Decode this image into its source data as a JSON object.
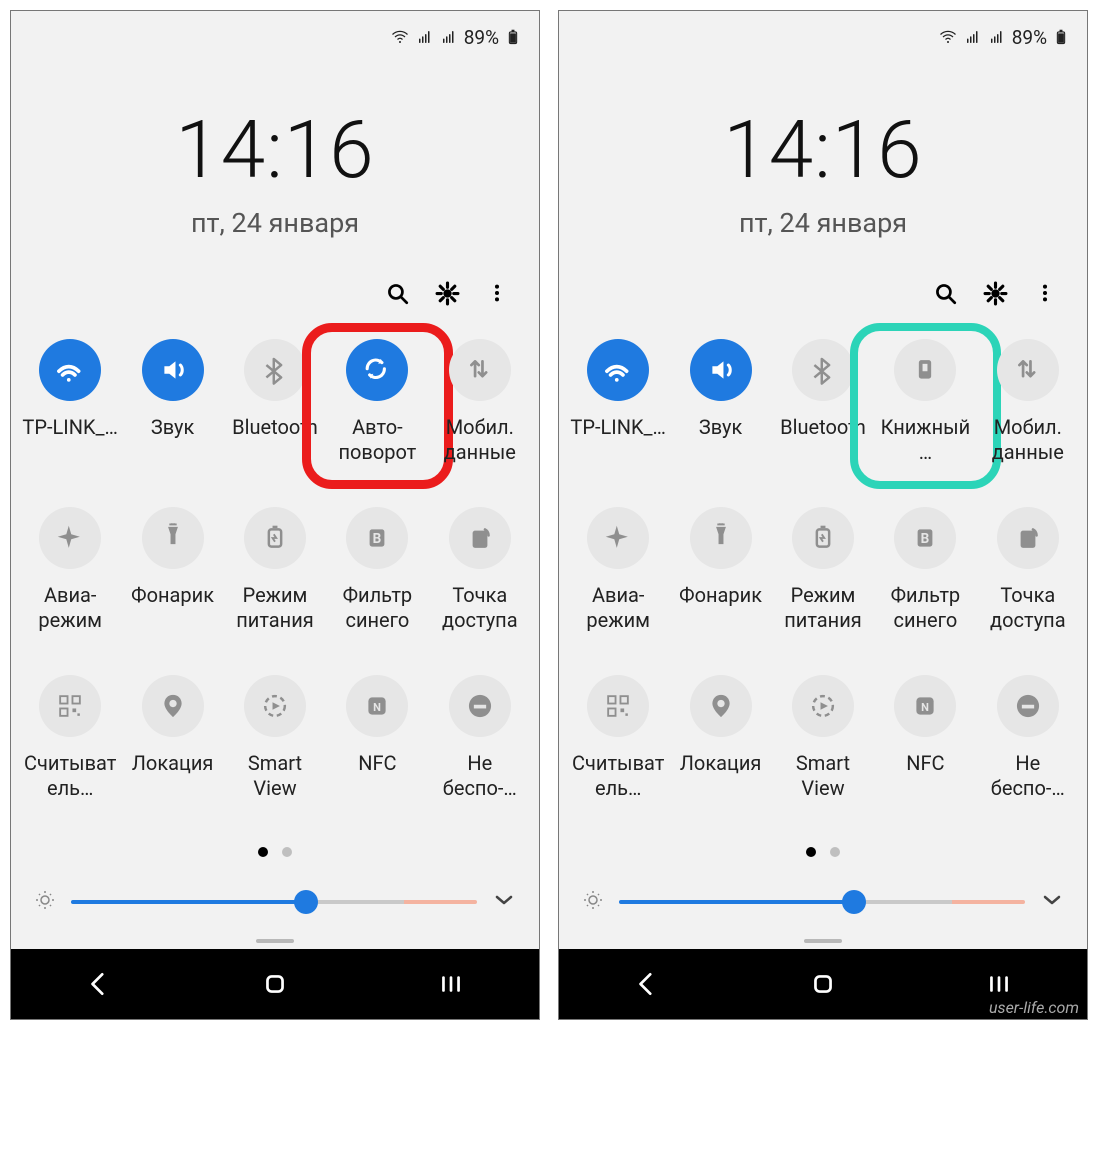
{
  "status": {
    "battery": "89%"
  },
  "clock": {
    "time": "14:16",
    "date": "пт, 24 января"
  },
  "tiles_left": [
    {
      "id": "wifi",
      "label": "TP-LINK_…",
      "on": true,
      "icon": "wifi"
    },
    {
      "id": "sound",
      "label": "Звук",
      "on": true,
      "icon": "sound"
    },
    {
      "id": "bluetooth",
      "label": "Bluetooth",
      "on": false,
      "icon": "bluetooth"
    },
    {
      "id": "rotate",
      "label": "Авто-поворот",
      "on": true,
      "icon": "rotate",
      "highlight": "red"
    },
    {
      "id": "data",
      "label": "Мобил. данные",
      "on": false,
      "icon": "data"
    },
    {
      "id": "airplane",
      "label": "Авиа-режим",
      "on": false,
      "icon": "airplane"
    },
    {
      "id": "torch",
      "label": "Фонарик",
      "on": false,
      "icon": "torch"
    },
    {
      "id": "power",
      "label": "Режим питания",
      "on": false,
      "icon": "battery"
    },
    {
      "id": "bluelight",
      "label": "Фильтр синего",
      "on": false,
      "icon": "filter"
    },
    {
      "id": "hotspot",
      "label": "Точка доступа",
      "on": false,
      "icon": "hotspot"
    },
    {
      "id": "scanner",
      "label": "Считыватель…",
      "on": false,
      "icon": "qr"
    },
    {
      "id": "location",
      "label": "Локация",
      "on": false,
      "icon": "location"
    },
    {
      "id": "smartview",
      "label": "Smart View",
      "on": false,
      "icon": "smartview"
    },
    {
      "id": "nfc",
      "label": "NFC",
      "on": false,
      "icon": "nfc"
    },
    {
      "id": "dnd",
      "label": "Не беспо-…",
      "on": false,
      "icon": "dnd"
    }
  ],
  "tiles_right": [
    {
      "id": "wifi",
      "label": "TP-LINK_…",
      "on": true,
      "icon": "wifi"
    },
    {
      "id": "sound",
      "label": "Звук",
      "on": true,
      "icon": "sound"
    },
    {
      "id": "bluetooth",
      "label": "Bluetooth",
      "on": false,
      "icon": "bluetooth"
    },
    {
      "id": "portrait",
      "label": "Книжный…",
      "on": false,
      "icon": "portrait",
      "highlight": "teal"
    },
    {
      "id": "data",
      "label": "Мобил. данные",
      "on": false,
      "icon": "data"
    },
    {
      "id": "airplane",
      "label": "Авиа-режим",
      "on": false,
      "icon": "airplane"
    },
    {
      "id": "torch",
      "label": "Фонарик",
      "on": false,
      "icon": "torch"
    },
    {
      "id": "power",
      "label": "Режим питания",
      "on": false,
      "icon": "battery"
    },
    {
      "id": "bluelight",
      "label": "Фильтр синего",
      "on": false,
      "icon": "filter"
    },
    {
      "id": "hotspot",
      "label": "Точка доступа",
      "on": false,
      "icon": "hotspot"
    },
    {
      "id": "scanner",
      "label": "Считыватель…",
      "on": false,
      "icon": "qr"
    },
    {
      "id": "location",
      "label": "Локация",
      "on": false,
      "icon": "location"
    },
    {
      "id": "smartview",
      "label": "Smart View",
      "on": false,
      "icon": "smartview"
    },
    {
      "id": "nfc",
      "label": "NFC",
      "on": false,
      "icon": "nfc"
    },
    {
      "id": "dnd",
      "label": "Не беспо-…",
      "on": false,
      "icon": "dnd"
    }
  ],
  "watermark": "user-life.com"
}
